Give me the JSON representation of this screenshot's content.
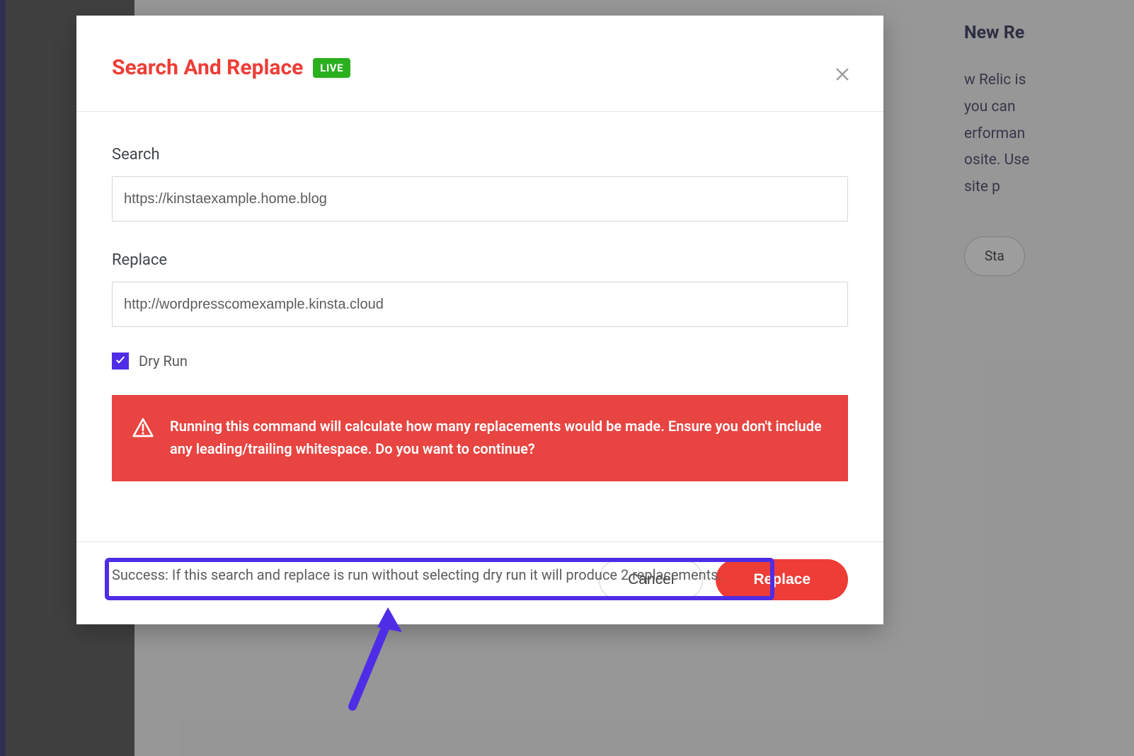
{
  "modal": {
    "title": "Search And Replace",
    "badge": "LIVE"
  },
  "fields": {
    "search_label": "Search",
    "search_value": "https://kinstaexample.home.blog",
    "replace_label": "Replace",
    "replace_value": "http://wordpresscomexample.kinsta.cloud"
  },
  "dry_run": {
    "label": "Dry Run",
    "checked": true
  },
  "warning": {
    "message": "Running this command will calculate how many replacements would be made. Ensure you don't include any leading/trailing whitespace. Do you want to continue?"
  },
  "result": {
    "text": "Success: If this search and replace is run without selecting dry run it will produce 2 replacements."
  },
  "footer": {
    "cancel": "Cancel",
    "replace": "Replace"
  },
  "background": {
    "heading": "New Re",
    "body_lines": [
      "w Relic is",
      "you can",
      "erforman",
      "osite. Use",
      "site p"
    ],
    "pill": "Sta"
  }
}
